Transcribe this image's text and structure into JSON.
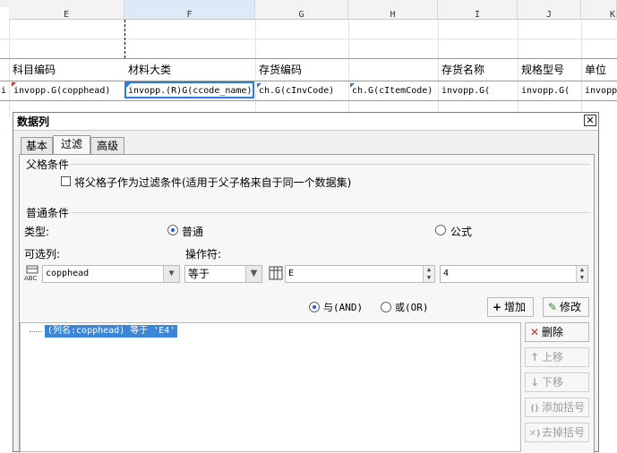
{
  "sheet": {
    "columns": [
      "E",
      "F",
      "G",
      "H",
      "I",
      "J",
      "K"
    ],
    "row_left_fragment": "i",
    "header_row": [
      "科目编码",
      "材料大类",
      "存货编码",
      "",
      "存货名称",
      "规格型号",
      "单位"
    ],
    "expr_row": [
      "invopp.G(copphead)",
      "invopp.(R)G(ccode_name)",
      "ch.G(cInvCode)",
      "ch.G(cItemCode)",
      "invopp.G(",
      "invopp.G(",
      "invopp"
    ],
    "selected_column": "F"
  },
  "dialog": {
    "title": "数据列",
    "close_glyph": "✕",
    "tabs": [
      "基本",
      "过滤",
      "高级"
    ],
    "active_tab": "过滤",
    "parent_section": "父格条件",
    "parent_checkbox_label": "将父格子作为过滤条件(适用于父子格来自于同一个数据集)",
    "parent_checkbox_checked": false,
    "normal_section": "普通条件",
    "type_label": "类型:",
    "type_options": [
      "普通",
      "公式"
    ],
    "type_selected": "普通",
    "available_col_label": "可选列:",
    "operator_label": "操作符:",
    "column_value": "copphead",
    "operator_value": "等于",
    "value_input": "E",
    "number_input": "4",
    "logic_options": [
      "与(AND)",
      "或(OR)"
    ],
    "logic_selected": "与(AND)",
    "add_button": "增加",
    "modify_button": "修改",
    "conditions": [
      "(列名:copphead) 等于 'E4'"
    ],
    "side_buttons": [
      {
        "label": "删除",
        "icon": "delete-icon",
        "enabled": true
      },
      {
        "label": "上移",
        "icon": "arrow-up-icon",
        "enabled": false
      },
      {
        "label": "下移",
        "icon": "arrow-down-icon",
        "enabled": false
      },
      {
        "label": "添加括号",
        "icon": "bracket-add-icon",
        "enabled": false
      },
      {
        "label": "去掉括号",
        "icon": "bracket-remove-icon",
        "enabled": false
      }
    ]
  },
  "colors": {
    "accent": "#2a7be4",
    "selection": "#3a86d8",
    "delete_red": "#d42a2a"
  }
}
